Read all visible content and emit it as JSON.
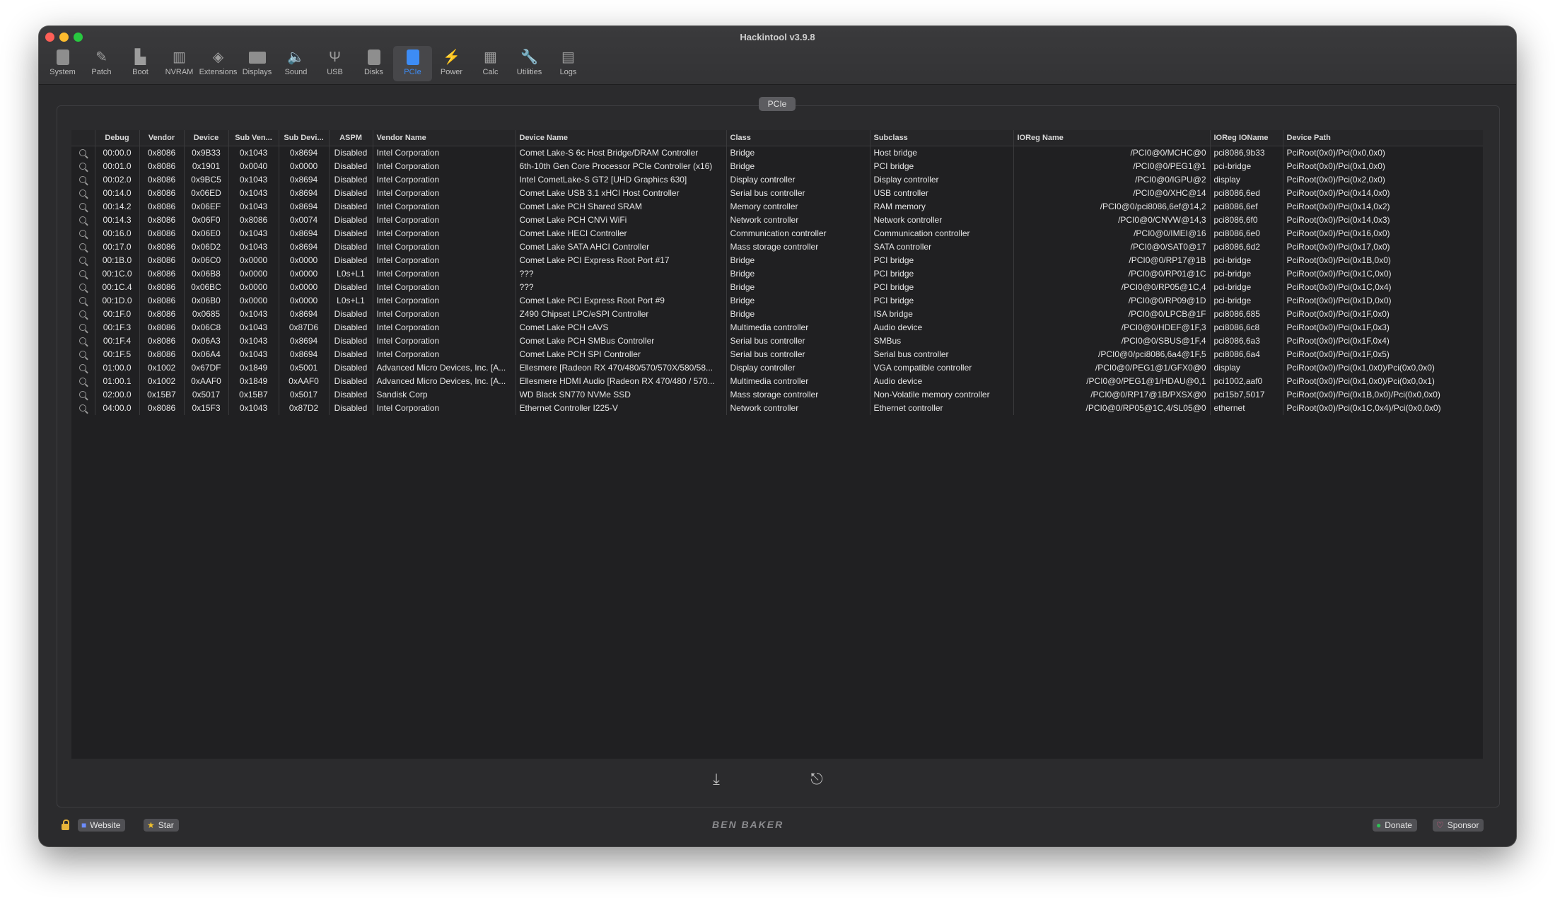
{
  "window": {
    "title": "Hackintool v3.9.8"
  },
  "toolbar": {
    "items": [
      {
        "label": "System",
        "icon": "system-icon"
      },
      {
        "label": "Patch",
        "icon": "patch-icon"
      },
      {
        "label": "Boot",
        "icon": "boot-icon"
      },
      {
        "label": "NVRAM",
        "icon": "nvram-icon"
      },
      {
        "label": "Extensions",
        "icon": "extensions-icon"
      },
      {
        "label": "Displays",
        "icon": "displays-icon"
      },
      {
        "label": "Sound",
        "icon": "sound-icon"
      },
      {
        "label": "USB",
        "icon": "usb-icon"
      },
      {
        "label": "Disks",
        "icon": "disks-icon"
      },
      {
        "label": "PCIe",
        "icon": "pcie-icon",
        "active": true
      },
      {
        "label": "Power",
        "icon": "power-icon"
      },
      {
        "label": "Calc",
        "icon": "calc-icon"
      },
      {
        "label": "Utilities",
        "icon": "utilities-icon"
      },
      {
        "label": "Logs",
        "icon": "logs-icon"
      }
    ]
  },
  "section": {
    "title": "PCIe"
  },
  "table": {
    "columns": [
      "",
      "Debug",
      "Vendor",
      "Device",
      "Sub Ven...",
      "Sub Devi...",
      "ASPM",
      "Vendor Name",
      "Device Name",
      "Class",
      "Subclass",
      "IOReg Name",
      "IOReg IOName",
      "Device Path"
    ],
    "rows": [
      [
        "00:00.0",
        "0x8086",
        "0x9B33",
        "0x1043",
        "0x8694",
        "Disabled",
        "Intel Corporation",
        "Comet Lake-S 6c Host Bridge/DRAM Controller",
        "Bridge",
        "Host bridge",
        "/PCI0@0/MCHC@0",
        "pci8086,9b33",
        "PciRoot(0x0)/Pci(0x0,0x0)"
      ],
      [
        "00:01.0",
        "0x8086",
        "0x1901",
        "0x0040",
        "0x0000",
        "Disabled",
        "Intel Corporation",
        "6th-10th Gen Core Processor PCIe Controller (x16)",
        "Bridge",
        "PCI bridge",
        "/PCI0@0/PEG1@1",
        "pci-bridge",
        "PciRoot(0x0)/Pci(0x1,0x0)"
      ],
      [
        "00:02.0",
        "0x8086",
        "0x9BC5",
        "0x1043",
        "0x8694",
        "Disabled",
        "Intel Corporation",
        "Intel CometLake-S GT2 [UHD Graphics 630]",
        "Display controller",
        "Display controller",
        "/PCI0@0/IGPU@2",
        "display",
        "PciRoot(0x0)/Pci(0x2,0x0)"
      ],
      [
        "00:14.0",
        "0x8086",
        "0x06ED",
        "0x1043",
        "0x8694",
        "Disabled",
        "Intel Corporation",
        "Comet Lake USB 3.1 xHCI Host Controller",
        "Serial bus controller",
        "USB controller",
        "/PCI0@0/XHC@14",
        "pci8086,6ed",
        "PciRoot(0x0)/Pci(0x14,0x0)"
      ],
      [
        "00:14.2",
        "0x8086",
        "0x06EF",
        "0x1043",
        "0x8694",
        "Disabled",
        "Intel Corporation",
        "Comet Lake PCH Shared SRAM",
        "Memory controller",
        "RAM memory",
        "/PCI0@0/pci8086,6ef@14,2",
        "pci8086,6ef",
        "PciRoot(0x0)/Pci(0x14,0x2)"
      ],
      [
        "00:14.3",
        "0x8086",
        "0x06F0",
        "0x8086",
        "0x0074",
        "Disabled",
        "Intel Corporation",
        "Comet Lake PCH CNVi WiFi",
        "Network controller",
        "Network controller",
        "/PCI0@0/CNVW@14,3",
        "pci8086,6f0",
        "PciRoot(0x0)/Pci(0x14,0x3)"
      ],
      [
        "00:16.0",
        "0x8086",
        "0x06E0",
        "0x1043",
        "0x8694",
        "Disabled",
        "Intel Corporation",
        "Comet Lake HECI Controller",
        "Communication controller",
        "Communication controller",
        "/PCI0@0/IMEI@16",
        "pci8086,6e0",
        "PciRoot(0x0)/Pci(0x16,0x0)"
      ],
      [
        "00:17.0",
        "0x8086",
        "0x06D2",
        "0x1043",
        "0x8694",
        "Disabled",
        "Intel Corporation",
        "Comet Lake SATA AHCI Controller",
        "Mass storage controller",
        "SATA controller",
        "/PCI0@0/SAT0@17",
        "pci8086,6d2",
        "PciRoot(0x0)/Pci(0x17,0x0)"
      ],
      [
        "00:1B.0",
        "0x8086",
        "0x06C0",
        "0x0000",
        "0x0000",
        "Disabled",
        "Intel Corporation",
        "Comet Lake PCI Express Root Port #17",
        "Bridge",
        "PCI bridge",
        "/PCI0@0/RP17@1B",
        "pci-bridge",
        "PciRoot(0x0)/Pci(0x1B,0x0)"
      ],
      [
        "00:1C.0",
        "0x8086",
        "0x06B8",
        "0x0000",
        "0x0000",
        "L0s+L1",
        "Intel Corporation",
        "???",
        "Bridge",
        "PCI bridge",
        "/PCI0@0/RP01@1C",
        "pci-bridge",
        "PciRoot(0x0)/Pci(0x1C,0x0)"
      ],
      [
        "00:1C.4",
        "0x8086",
        "0x06BC",
        "0x0000",
        "0x0000",
        "Disabled",
        "Intel Corporation",
        "???",
        "Bridge",
        "PCI bridge",
        "/PCI0@0/RP05@1C,4",
        "pci-bridge",
        "PciRoot(0x0)/Pci(0x1C,0x4)"
      ],
      [
        "00:1D.0",
        "0x8086",
        "0x06B0",
        "0x0000",
        "0x0000",
        "L0s+L1",
        "Intel Corporation",
        "Comet Lake PCI Express Root Port #9",
        "Bridge",
        "PCI bridge",
        "/PCI0@0/RP09@1D",
        "pci-bridge",
        "PciRoot(0x0)/Pci(0x1D,0x0)"
      ],
      [
        "00:1F.0",
        "0x8086",
        "0x0685",
        "0x1043",
        "0x8694",
        "Disabled",
        "Intel Corporation",
        "Z490 Chipset LPC/eSPI Controller",
        "Bridge",
        "ISA bridge",
        "/PCI0@0/LPCB@1F",
        "pci8086,685",
        "PciRoot(0x0)/Pci(0x1F,0x0)"
      ],
      [
        "00:1F.3",
        "0x8086",
        "0x06C8",
        "0x1043",
        "0x87D6",
        "Disabled",
        "Intel Corporation",
        "Comet Lake PCH cAVS",
        "Multimedia controller",
        "Audio device",
        "/PCI0@0/HDEF@1F,3",
        "pci8086,6c8",
        "PciRoot(0x0)/Pci(0x1F,0x3)"
      ],
      [
        "00:1F.4",
        "0x8086",
        "0x06A3",
        "0x1043",
        "0x8694",
        "Disabled",
        "Intel Corporation",
        "Comet Lake PCH SMBus Controller",
        "Serial bus controller",
        "SMBus",
        "/PCI0@0/SBUS@1F,4",
        "pci8086,6a3",
        "PciRoot(0x0)/Pci(0x1F,0x4)"
      ],
      [
        "00:1F.5",
        "0x8086",
        "0x06A4",
        "0x1043",
        "0x8694",
        "Disabled",
        "Intel Corporation",
        "Comet Lake PCH SPI Controller",
        "Serial bus controller",
        "Serial bus controller",
        "/PCI0@0/pci8086,6a4@1F,5",
        "pci8086,6a4",
        "PciRoot(0x0)/Pci(0x1F,0x5)"
      ],
      [
        "01:00.0",
        "0x1002",
        "0x67DF",
        "0x1849",
        "0x5001",
        "Disabled",
        "Advanced Micro Devices, Inc. [A...",
        "Ellesmere [Radeon RX 470/480/570/570X/580/58...",
        "Display controller",
        "VGA compatible controller",
        "/PCI0@0/PEG1@1/GFX0@0",
        "display",
        "PciRoot(0x0)/Pci(0x1,0x0)/Pci(0x0,0x0)"
      ],
      [
        "01:00.1",
        "0x1002",
        "0xAAF0",
        "0x1849",
        "0xAAF0",
        "Disabled",
        "Advanced Micro Devices, Inc. [A...",
        "Ellesmere HDMI Audio [Radeon RX 470/480 / 570...",
        "Multimedia controller",
        "Audio device",
        "/PCI0@0/PEG1@1/HDAU@0,1",
        "pci1002,aaf0",
        "PciRoot(0x0)/Pci(0x1,0x0)/Pci(0x0,0x1)"
      ],
      [
        "02:00.0",
        "0x15B7",
        "0x5017",
        "0x15B7",
        "0x5017",
        "Disabled",
        "Sandisk Corp",
        "WD Black SN770 NVMe SSD",
        "Mass storage controller",
        "Non-Volatile memory controller",
        "/PCI0@0/RP17@1B/PXSX@0",
        "pci15b7,5017",
        "PciRoot(0x0)/Pci(0x1B,0x0)/Pci(0x0,0x0)"
      ],
      [
        "04:00.0",
        "0x8086",
        "0x15F3",
        "0x1043",
        "0x87D2",
        "Disabled",
        "Intel Corporation",
        "Ethernet Controller I225-V",
        "Network controller",
        "Ethernet controller",
        "/PCI0@0/RP05@1C,4/SL05@0",
        "ethernet",
        "PciRoot(0x0)/Pci(0x1C,0x4)/Pci(0x0,0x0)"
      ]
    ]
  },
  "bottom": {
    "export_icon": "download-icon",
    "exit_icon": "exit-icon"
  },
  "footer": {
    "website_label": "Website",
    "star_label": "Star",
    "brand": "BEN BAKER",
    "donate_label": "Donate",
    "sponsor_label": "Sponsor"
  }
}
